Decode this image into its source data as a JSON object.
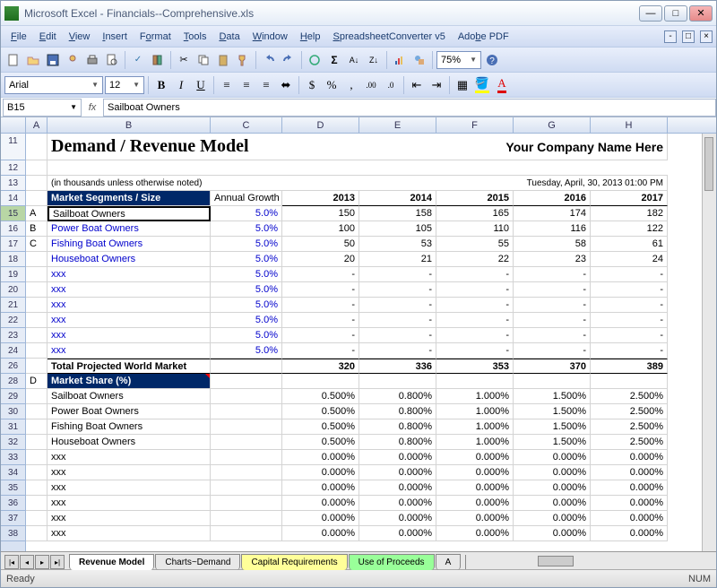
{
  "window": {
    "title": "Microsoft Excel - Financials--Comprehensive.xls"
  },
  "menubar": [
    "File",
    "Edit",
    "View",
    "Insert",
    "Format",
    "Tools",
    "Data",
    "Window",
    "Help",
    "SpreadsheetConverter v5",
    "Adobe PDF"
  ],
  "toolbar": {
    "zoom": "75%"
  },
  "format": {
    "font": "Arial",
    "size": "12"
  },
  "formulabar": {
    "name": "B15",
    "fx_label": "fx",
    "value": "Sailboat Owners"
  },
  "columns": [
    "A",
    "B",
    "C",
    "D",
    "E",
    "F",
    "G",
    "H"
  ],
  "rows_visible": [
    11,
    12,
    13,
    14,
    15,
    16,
    17,
    18,
    19,
    20,
    21,
    22,
    23,
    24,
    26,
    28,
    29,
    30,
    31,
    32,
    33,
    34,
    35,
    36,
    37,
    38
  ],
  "sheet": {
    "title": "Demand / Revenue Model",
    "company": "Your Company Name Here",
    "subtitle": "(in thousands unless otherwise noted)",
    "datestamp": "Tuesday, April, 30, 2013 01:00 PM",
    "section1_header": "Market Segments / Size",
    "annual_growth_label": "Annual Growth",
    "years": [
      "2013",
      "2014",
      "2015",
      "2016",
      "2017"
    ],
    "row_letters": [
      "A",
      "B",
      "C",
      "",
      "",
      "",
      "",
      "",
      "",
      ""
    ],
    "segments": [
      "Sailboat Owners",
      "Power Boat Owners",
      "Fishing Boat Owners",
      "Houseboat Owners",
      "xxx",
      "xxx",
      "xxx",
      "xxx",
      "xxx",
      "xxx"
    ],
    "growth": [
      "5.0%",
      "5.0%",
      "5.0%",
      "5.0%",
      "5.0%",
      "5.0%",
      "5.0%",
      "5.0%",
      "5.0%",
      "5.0%"
    ],
    "values": [
      [
        "150",
        "158",
        "165",
        "174",
        "182"
      ],
      [
        "100",
        "105",
        "110",
        "116",
        "122"
      ],
      [
        "50",
        "53",
        "55",
        "58",
        "61"
      ],
      [
        "20",
        "21",
        "22",
        "23",
        "24"
      ],
      [
        "-",
        "-",
        "-",
        "-",
        "-"
      ],
      [
        "-",
        "-",
        "-",
        "-",
        "-"
      ],
      [
        "-",
        "-",
        "-",
        "-",
        "-"
      ],
      [
        "-",
        "-",
        "-",
        "-",
        "-"
      ],
      [
        "-",
        "-",
        "-",
        "-",
        "-"
      ],
      [
        "-",
        "-",
        "-",
        "-",
        "-"
      ]
    ],
    "total_label": "Total Projected World Market",
    "totals": [
      "320",
      "336",
      "353",
      "370",
      "389"
    ],
    "section2_header": "Market Share (%)",
    "section2_letter": "D",
    "share_labels": [
      "Sailboat Owners",
      "Power Boat Owners",
      "Fishing Boat Owners",
      "Houseboat Owners",
      "xxx",
      "xxx",
      "xxx",
      "xxx",
      "xxx",
      "xxx"
    ],
    "share_values": [
      [
        "0.500%",
        "0.800%",
        "1.000%",
        "1.500%",
        "2.500%"
      ],
      [
        "0.500%",
        "0.800%",
        "1.000%",
        "1.500%",
        "2.500%"
      ],
      [
        "0.500%",
        "0.800%",
        "1.000%",
        "1.500%",
        "2.500%"
      ],
      [
        "0.500%",
        "0.800%",
        "1.000%",
        "1.500%",
        "2.500%"
      ],
      [
        "0.000%",
        "0.000%",
        "0.000%",
        "0.000%",
        "0.000%"
      ],
      [
        "0.000%",
        "0.000%",
        "0.000%",
        "0.000%",
        "0.000%"
      ],
      [
        "0.000%",
        "0.000%",
        "0.000%",
        "0.000%",
        "0.000%"
      ],
      [
        "0.000%",
        "0.000%",
        "0.000%",
        "0.000%",
        "0.000%"
      ],
      [
        "0.000%",
        "0.000%",
        "0.000%",
        "0.000%",
        "0.000%"
      ],
      [
        "0.000%",
        "0.000%",
        "0.000%",
        "0.000%",
        "0.000%"
      ]
    ]
  },
  "tabs": {
    "items": [
      "Revenue Model",
      "Charts~Demand",
      "Capital Requirements",
      "Use of Proceeds",
      "A"
    ],
    "active_index": 0
  },
  "statusbar": {
    "left": "Ready",
    "right": "NUM"
  }
}
